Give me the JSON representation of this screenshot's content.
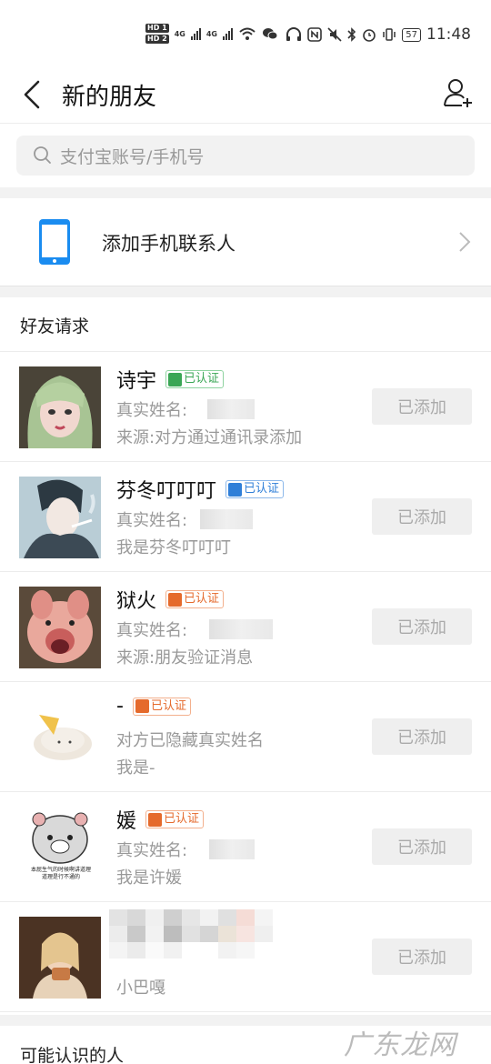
{
  "status_bar": {
    "hd1": "HD 1",
    "hd2": "HD 2",
    "net1": "4G",
    "net2": "4G",
    "battery": "57",
    "time": "11:48"
  },
  "header": {
    "title": "新的朋友"
  },
  "search": {
    "placeholder": "支付宝账号/手机号"
  },
  "add_contacts": {
    "label": "添加手机联系人"
  },
  "friend_requests": {
    "title": "好友请求",
    "items": [
      {
        "name": "诗宇",
        "badge": "已认证",
        "badge_color": "green",
        "realname_label": "真实姓名:",
        "line3": "来源:对方通过通讯录添加",
        "button": "已添加"
      },
      {
        "name": "芬冬叮叮叮",
        "badge": "已认证",
        "badge_color": "blue",
        "realname_label": "真实姓名:",
        "line3": "我是芬冬叮叮叮",
        "button": "已添加"
      },
      {
        "name": "狱火",
        "badge": "已认证",
        "badge_color": "orange",
        "realname_label": "真实姓名:",
        "line3": "来源:朋友验证消息",
        "button": "已添加"
      },
      {
        "name": "-",
        "badge": "已认证",
        "badge_color": "orange",
        "realname_label": "对方已隐藏真实姓名",
        "line3": "我是-",
        "button": "已添加"
      },
      {
        "name": "媛",
        "badge": "已认证",
        "badge_color": "orange",
        "realname_label": "真实姓名:",
        "line3": "我是许媛",
        "button": "已添加"
      },
      {
        "name": "",
        "badge": "",
        "badge_color": "",
        "realname_label": "",
        "line3": "小巴嘎",
        "button": "已添加"
      }
    ]
  },
  "may_know": {
    "title": "可能认识的人"
  },
  "avatar5_caption": "本屁生气的时候啊讲道理\n道理是行不通的",
  "watermark": "广东龙网",
  "colors": {
    "accent_blue": "#1a8cf0",
    "badge_green": "#3aa655",
    "badge_blue": "#2f7fd8",
    "badge_orange": "#e56a2c"
  }
}
